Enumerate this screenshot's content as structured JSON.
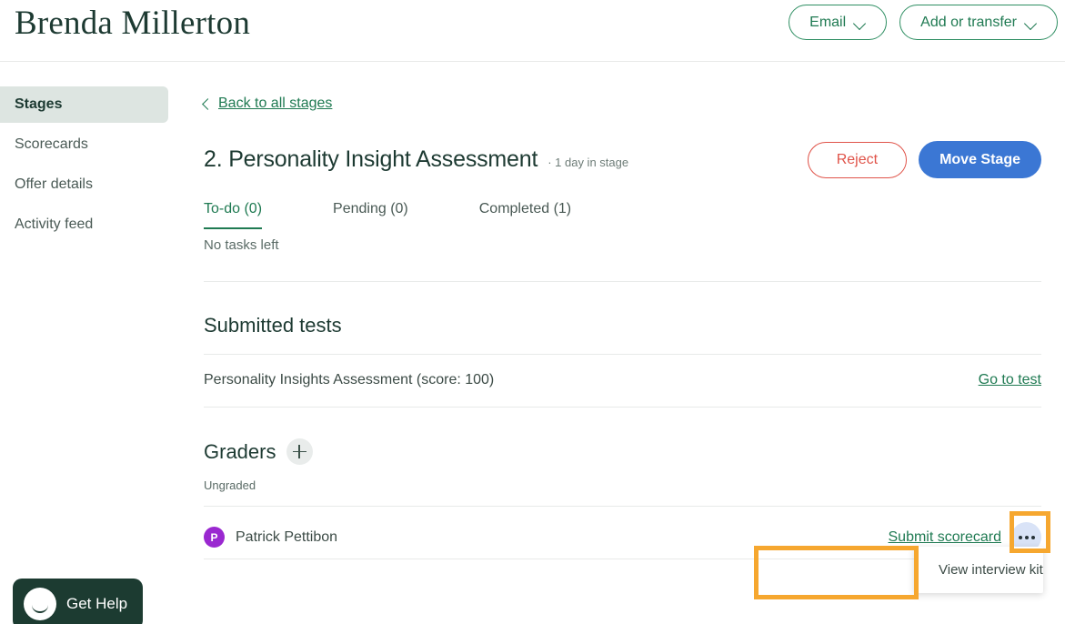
{
  "header": {
    "candidate_name": "Brenda Millerton",
    "email_button": "Email",
    "add_transfer_button": "Add or transfer"
  },
  "sidebar": {
    "items": [
      {
        "label": "Stages",
        "active": true
      },
      {
        "label": "Scorecards",
        "active": false
      },
      {
        "label": "Offer details",
        "active": false
      },
      {
        "label": "Activity feed",
        "active": false
      }
    ]
  },
  "main": {
    "back_link": "Back to all stages",
    "stage_title": "2. Personality Insight Assessment",
    "stage_meta": "· 1 day in stage",
    "reject_button": "Reject",
    "move_stage_button": "Move Stage",
    "tabs": [
      {
        "label": "To-do (0)",
        "active": true
      },
      {
        "label": "Pending (0)",
        "active": false
      },
      {
        "label": "Completed (1)",
        "active": false
      }
    ],
    "no_tasks_text": "No tasks left",
    "submitted_tests": {
      "heading": "Submitted tests",
      "test_name": "Personality Insights Assessment (score: 100)",
      "go_to_test_link": "Go to test"
    },
    "graders": {
      "heading": "Graders",
      "add_icon": "plus-icon",
      "status": "Ungraded",
      "grader_name": "Patrick Pettibon",
      "grader_initial": "P",
      "submit_scorecard_link": "Submit scorecard",
      "more_icon": "ellipsis-icon"
    },
    "dropdown": {
      "items": [
        "View interview kit"
      ]
    }
  },
  "help_widget": {
    "label": "Get Help",
    "icon": "smiley-face-icon"
  },
  "colors": {
    "brand_green": "#1f7a52",
    "dark_green": "#1d3a32",
    "sidebar_active_bg": "#dde5e1",
    "reject_red": "#e0544a",
    "move_stage_blue": "#3b77d4",
    "avatar_purple": "#9a28d0",
    "more_button_bg": "#d9e3f7",
    "highlight_orange": "#f6a72f",
    "help_widget_bg": "#1c3b31"
  }
}
